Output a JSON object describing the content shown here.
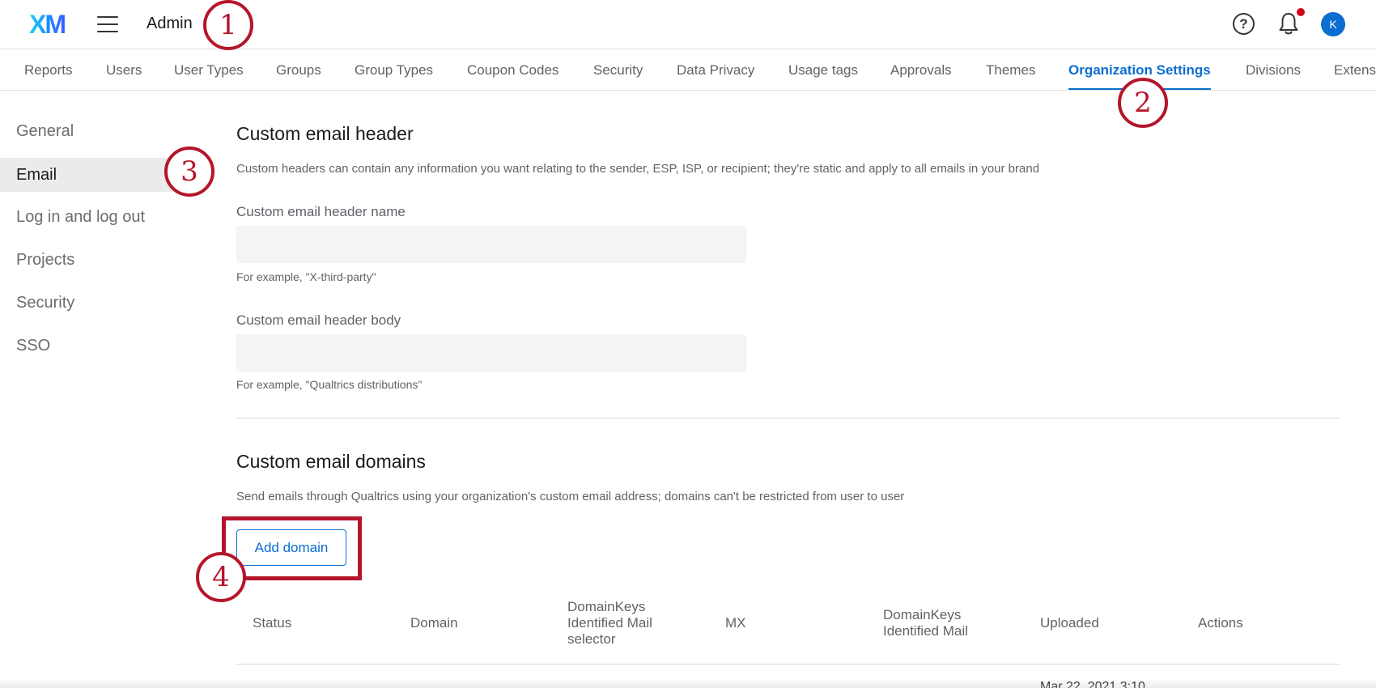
{
  "header": {
    "logo": "XM",
    "title": "Admin",
    "help_glyph": "?",
    "avatar_initial": "K"
  },
  "nav_tabs": [
    {
      "label": "Reports"
    },
    {
      "label": "Users"
    },
    {
      "label": "User Types"
    },
    {
      "label": "Groups"
    },
    {
      "label": "Group Types"
    },
    {
      "label": "Coupon Codes"
    },
    {
      "label": "Security"
    },
    {
      "label": "Data Privacy"
    },
    {
      "label": "Usage tags"
    },
    {
      "label": "Approvals"
    },
    {
      "label": "Themes"
    },
    {
      "label": "Organization Settings",
      "active": true
    },
    {
      "label": "Divisions"
    },
    {
      "label": "Extens"
    }
  ],
  "sidebar": {
    "items": [
      {
        "label": "General"
      },
      {
        "label": "Email",
        "active": true
      },
      {
        "label": "Log in and log out"
      },
      {
        "label": "Projects"
      },
      {
        "label": "Security"
      },
      {
        "label": "SSO"
      }
    ]
  },
  "email_header": {
    "title": "Custom email header",
    "description": "Custom headers can contain any information you want relating to the sender, ESP, ISP, or recipient; they're static and apply to all emails in your brand",
    "name_label": "Custom email header name",
    "name_value": "",
    "name_hint": "For example, \"X-third-party\"",
    "body_label": "Custom email header body",
    "body_value": "",
    "body_hint": "For example, \"Qualtrics distributions\""
  },
  "email_domains": {
    "title": "Custom email domains",
    "description": "Send emails through Qualtrics using your organization's custom email address; domains can't be restricted from user to user",
    "add_button": "Add domain",
    "columns": [
      "Status",
      "Domain",
      "DomainKeys Identified Mail selector",
      "MX",
      "DomainKeys Identified Mail",
      "Uploaded",
      "Actions"
    ],
    "partial_row_uploaded": "Mar 22, 2021 3:10"
  },
  "callouts": [
    "1",
    "2",
    "3",
    "4"
  ],
  "colors": {
    "accent": "#0b6ed0",
    "callout": "#b5152b",
    "notification_dot": "#d0021b"
  },
  "icons": [
    "menu-icon",
    "help-icon",
    "bell-icon"
  ]
}
